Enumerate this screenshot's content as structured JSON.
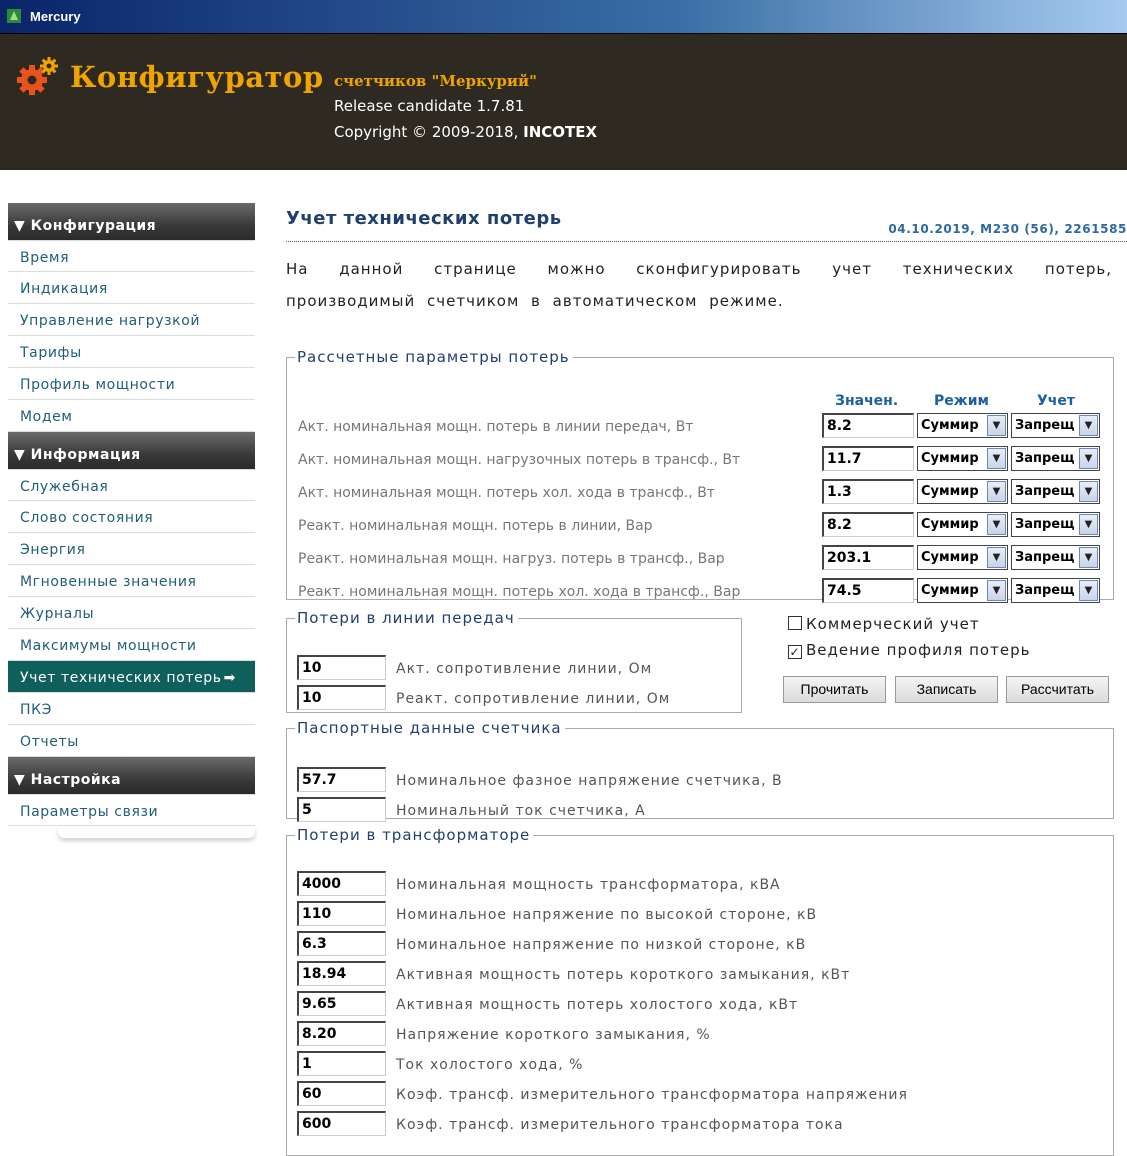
{
  "window": {
    "title": "Mercury"
  },
  "banner": {
    "product": "Конфигуратор",
    "subtitle": "счетчиков \"Меркурий\"",
    "release": "Release candidate 1.7.81",
    "copyright_prefix": "Copyright © 2009-2018, ",
    "copyright_company": "INCOTEX"
  },
  "sidebar": {
    "sections": [
      {
        "title": "▼ Конфигурация",
        "items": [
          "Время",
          "Индикация",
          "Управление нагрузкой",
          "Тарифы",
          "Профиль мощности",
          "Модем"
        ]
      },
      {
        "title": "▼ Информация",
        "items": [
          "Служебная",
          "Слово состояния",
          "Энергия",
          "Мгновенные значения",
          "Журналы",
          "Максимумы мощности",
          "Учет технических потерь",
          "ПКЭ",
          "Отчеты"
        ]
      },
      {
        "title": "▼ Настройка",
        "items": [
          "Параметры связи"
        ]
      }
    ],
    "active_item": "Учет технических потерь",
    "active_arrow": "➡"
  },
  "page": {
    "title": "Учет технических потерь",
    "meta": "04.10.2019, M230 (56), 2261585",
    "intro": "На данной странице можно сконфигурировать учет технических потерь, производимый счетчиком в автоматическом режиме."
  },
  "calc": {
    "legend": "Рассчетные параметры потерь",
    "col_value": "Значен.",
    "col_mode": "Режим",
    "col_account": "Учет",
    "rows": [
      {
        "label": "Акт. номинальная мощн. потерь в линии передач, Вт",
        "value": "8.2",
        "mode": "Суммир",
        "account": "Запрещ"
      },
      {
        "label": "Акт. номинальная мощн. нагрузочных потерь в трансф., Вт",
        "value": "11.7",
        "mode": "Суммир",
        "account": "Запрещ"
      },
      {
        "label": "Акт. номинальная мощн. потерь хол. хода в трансф., Вт",
        "value": "1.3",
        "mode": "Суммир",
        "account": "Запрещ"
      },
      {
        "label": "Реакт. номинальная мощн. потерь в линии, Вар",
        "value": "8.2",
        "mode": "Суммир",
        "account": "Запрещ"
      },
      {
        "label": "Реакт. номинальная мощн. нагруз. потерь в трансф., Вар",
        "value": "203.1",
        "mode": "Суммир",
        "account": "Запрещ"
      },
      {
        "label": "Реакт. номинальная мощн. потерь хол. хода в трансф., Вар",
        "value": "74.5",
        "mode": "Суммир",
        "account": "Запрещ"
      }
    ]
  },
  "line": {
    "legend": "Потери в линии передач",
    "fields": [
      {
        "label": "Акт. сопротивление линии, Ом",
        "value": "10"
      },
      {
        "label": "Реакт. сопротивление линии, Ом",
        "value": "10"
      }
    ]
  },
  "options": {
    "commercial": {
      "label": "Коммерческий учет",
      "checked": false
    },
    "profile": {
      "label": "Ведение профиля потерь",
      "checked": true
    }
  },
  "buttons": {
    "read": "Прочитать",
    "write": "Записать",
    "calc": "Рассчитать"
  },
  "passport": {
    "legend": "Паспортные данные счетчика",
    "fields": [
      {
        "label": "Номинальное фазное напряжение счетчика, В",
        "value": "57.7"
      },
      {
        "label": "Номинальный ток счетчика, А",
        "value": "5"
      }
    ]
  },
  "transformer": {
    "legend": "Потери в трансформаторе",
    "fields": [
      {
        "label": "Номинальная мощность трансформатора, кВА",
        "value": "4000"
      },
      {
        "label": "Номинальное напряжение по высокой стороне, кВ",
        "value": "110"
      },
      {
        "label": "Номинальное напряжение по низкой стороне, кВ",
        "value": "6.3"
      },
      {
        "label": "Активная мощность потерь короткого замыкания, кВт",
        "value": "18.94"
      },
      {
        "label": "Активная мощность потерь холостого хода, кВт",
        "value": "9.65"
      },
      {
        "label": "Напряжение короткого замыкания, %",
        "value": "8.20"
      },
      {
        "label": "Ток холостого хода, %",
        "value": "1"
      },
      {
        "label": "Коэф. трансф. измерительного трансформатора напряжения",
        "value": "60"
      },
      {
        "label": "Коэф. трансф. измерительного трансформатора тока",
        "value": "600"
      }
    ]
  },
  "colors": {
    "banner_bg": "#2e2a22",
    "brand_orange": "#f0a400",
    "active_nav": "#0f5f5c",
    "link": "#1f5f78"
  }
}
